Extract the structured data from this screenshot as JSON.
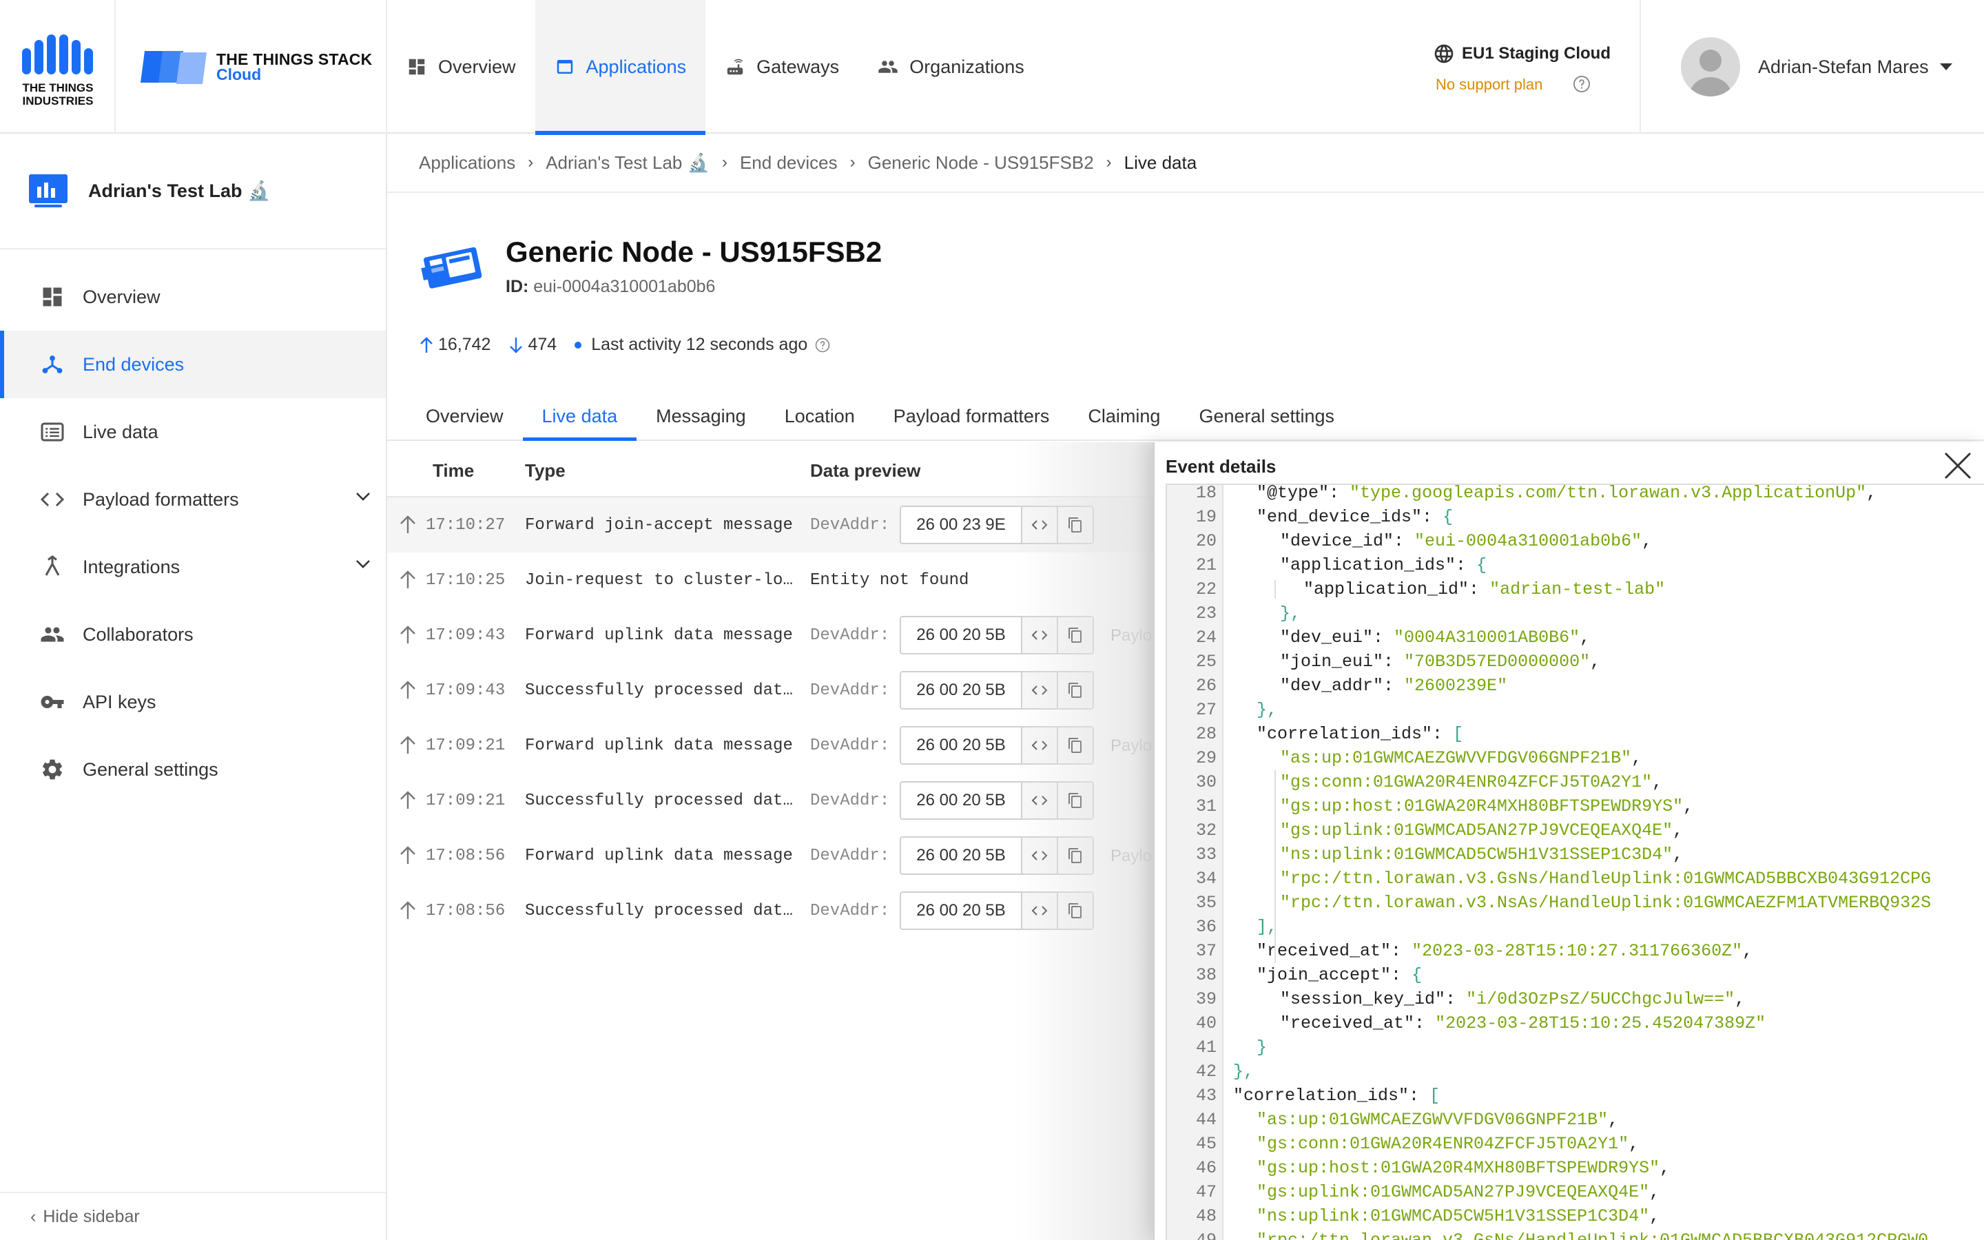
{
  "header": {
    "tti_logo_text": "THE THINGS INDUSTRIES",
    "tts_title": "THE THINGS STACK",
    "tts_subtitle": "Cloud",
    "nav": [
      {
        "label": "Overview",
        "active": false
      },
      {
        "label": "Applications",
        "active": true
      },
      {
        "label": "Gateways",
        "active": false
      },
      {
        "label": "Organizations",
        "active": false
      }
    ],
    "cloud_name": "EU1 Staging Cloud",
    "support_plan": "No support plan",
    "user_name": "Adrian-Stefan Mares"
  },
  "colors": {
    "accent": "#1b6ef3",
    "warning": "#d98b00",
    "json_string": "#7aa610",
    "json_punct": "#3aa38a"
  },
  "sidebar": {
    "app_title": "Adrian's Test Lab 🔬",
    "items": [
      {
        "label": "Overview",
        "icon": "dashboard-icon"
      },
      {
        "label": "End devices",
        "icon": "devices-icon",
        "active": true
      },
      {
        "label": "Live data",
        "icon": "list-icon"
      },
      {
        "label": "Payload formatters",
        "icon": "code-icon",
        "expandable": true
      },
      {
        "label": "Integrations",
        "icon": "merge-icon",
        "expandable": true
      },
      {
        "label": "Collaborators",
        "icon": "people-icon"
      },
      {
        "label": "API keys",
        "icon": "key-icon"
      },
      {
        "label": "General settings",
        "icon": "gear-icon"
      }
    ],
    "hide_label": "Hide sidebar"
  },
  "breadcrumb": [
    "Applications",
    "Adrian's Test Lab 🔬",
    "End devices",
    "Generic Node - US915FSB2",
    "Live data"
  ],
  "device": {
    "title": "Generic Node - US915FSB2",
    "id_label": "ID:",
    "id_value": "eui-0004a310001ab0b6",
    "uplinks": "16,742",
    "downlinks": "474",
    "last_activity": "Last activity 12 seconds ago"
  },
  "tabs": [
    "Overview",
    "Live data",
    "Messaging",
    "Location",
    "Payload formatters",
    "Claiming",
    "General settings"
  ],
  "events": {
    "columns": {
      "time": "Time",
      "type": "Type",
      "data": "Data preview"
    },
    "devaddr_label": "DevAddr:",
    "payload_label": "Paylo",
    "not_found": "Entity not found",
    "rows": [
      {
        "time": "17:10:27",
        "type": "Forward join-accept message",
        "addr": "26 00 23 9E",
        "payload": false
      },
      {
        "time": "17:10:25",
        "type": "Join-request to cluster-lo…",
        "addr": "",
        "payload": false
      },
      {
        "time": "17:09:43",
        "type": "Forward uplink data message",
        "addr": "26 00 20 5B",
        "payload": true
      },
      {
        "time": "17:09:43",
        "type": "Successfully processed dat…",
        "addr": "26 00 20 5B",
        "payload": false
      },
      {
        "time": "17:09:21",
        "type": "Forward uplink data message",
        "addr": "26 00 20 5B",
        "payload": true
      },
      {
        "time": "17:09:21",
        "type": "Successfully processed dat…",
        "addr": "26 00 20 5B",
        "payload": false
      },
      {
        "time": "17:08:56",
        "type": "Forward uplink data message",
        "addr": "26 00 20 5B",
        "payload": true
      },
      {
        "time": "17:08:56",
        "type": "Successfully processed dat…",
        "addr": "26 00 20 5B",
        "payload": false
      }
    ]
  },
  "details": {
    "title": "Event details",
    "lines": [
      {
        "n": "18",
        "i": 1,
        "k": "\"@type\"",
        "v": "\"type.googleapis.com/ttn.lorawan.v3.ApplicationUp\"",
        "e": ","
      },
      {
        "n": "19",
        "i": 1,
        "k": "\"end_device_ids\"",
        "v": "",
        "o": "{"
      },
      {
        "n": "20",
        "i": 2,
        "k": "\"device_id\"",
        "v": "\"eui-0004a310001ab0b6\"",
        "e": ","
      },
      {
        "n": "21",
        "i": 2,
        "k": "\"application_ids\"",
        "v": "",
        "o": "{"
      },
      {
        "n": "22",
        "i": 3,
        "k": "\"application_id\"",
        "v": "\"adrian-test-lab\"",
        "e": ""
      },
      {
        "n": "23",
        "i": 2,
        "c": "},"
      },
      {
        "n": "24",
        "i": 2,
        "k": "\"dev_eui\"",
        "v": "\"0004A310001AB0B6\"",
        "e": ","
      },
      {
        "n": "25",
        "i": 2,
        "k": "\"join_eui\"",
        "v": "\"70B3D57ED0000000\"",
        "e": ","
      },
      {
        "n": "26",
        "i": 2,
        "k": "\"dev_addr\"",
        "v": "\"2600239E\"",
        "e": ""
      },
      {
        "n": "27",
        "i": 1,
        "c": "},"
      },
      {
        "n": "28",
        "i": 1,
        "k": "\"correlation_ids\"",
        "v": "",
        "o": "["
      },
      {
        "n": "29",
        "i": 2,
        "a": "\"as:up:01GWMCAEZGWVVFDGV06GNPF21B\"",
        "e": ","
      },
      {
        "n": "30",
        "i": 2,
        "a": "\"gs:conn:01GWA20R4ENR04ZFCFJ5T0A2Y1\"",
        "e": ","
      },
      {
        "n": "31",
        "i": 2,
        "a": "\"gs:up:host:01GWA20R4MXH80BFTSPEWDR9YS\"",
        "e": ","
      },
      {
        "n": "32",
        "i": 2,
        "a": "\"gs:uplink:01GWMCAD5AN27PJ9VCEQEAXQ4E\"",
        "e": ","
      },
      {
        "n": "33",
        "i": 2,
        "a": "\"ns:uplink:01GWMCAD5CW5H1V31SSEP1C3D4\"",
        "e": ","
      },
      {
        "n": "34",
        "i": 2,
        "a": "\"rpc:/ttn.lorawan.v3.GsNs/HandleUplink:01GWMCAD5BBCXB043G912CPG",
        "e": ""
      },
      {
        "n": "35",
        "i": 2,
        "a": "\"rpc:/ttn.lorawan.v3.NsAs/HandleUplink:01GWMCAEZFM1ATVMERBQ932S",
        "e": ""
      },
      {
        "n": "36",
        "i": 1,
        "c": "],"
      },
      {
        "n": "37",
        "i": 1,
        "k": "\"received_at\"",
        "v": "\"2023-03-28T15:10:27.311766360Z\"",
        "e": ","
      },
      {
        "n": "38",
        "i": 1,
        "k": "\"join_accept\"",
        "v": "",
        "o": "{"
      },
      {
        "n": "39",
        "i": 2,
        "k": "\"session_key_id\"",
        "v": "\"i/0d3OzPsZ/5UCChgcJulw==\"",
        "e": ","
      },
      {
        "n": "40",
        "i": 2,
        "k": "\"received_at\"",
        "v": "\"2023-03-28T15:10:25.452047389Z\"",
        "e": ""
      },
      {
        "n": "41",
        "i": 1,
        "c": "}"
      },
      {
        "n": "42",
        "i": 0,
        "c": "},"
      },
      {
        "n": "43",
        "i": 0,
        "k": "\"correlation_ids\"",
        "v": "",
        "o": "["
      },
      {
        "n": "44",
        "i": 1,
        "a": "\"as:up:01GWMCAEZGWVVFDGV06GNPF21B\"",
        "e": ","
      },
      {
        "n": "45",
        "i": 1,
        "a": "\"gs:conn:01GWA20R4ENR04ZFCFJ5T0A2Y1\"",
        "e": ","
      },
      {
        "n": "46",
        "i": 1,
        "a": "\"gs:up:host:01GWA20R4MXH80BFTSPEWDR9YS\"",
        "e": ","
      },
      {
        "n": "47",
        "i": 1,
        "a": "\"gs:uplink:01GWMCAD5AN27PJ9VCEQEAXQ4E\"",
        "e": ","
      },
      {
        "n": "48",
        "i": 1,
        "a": "\"ns:uplink:01GWMCAD5CW5H1V31SSEP1C3D4\"",
        "e": ","
      },
      {
        "n": "49",
        "i": 1,
        "a": "\"rpc:/ttn.lorawan.v3.GsNs/HandleUplink:01GWMCAD5BBCXB043G912CPGW0",
        "e": ""
      }
    ]
  }
}
